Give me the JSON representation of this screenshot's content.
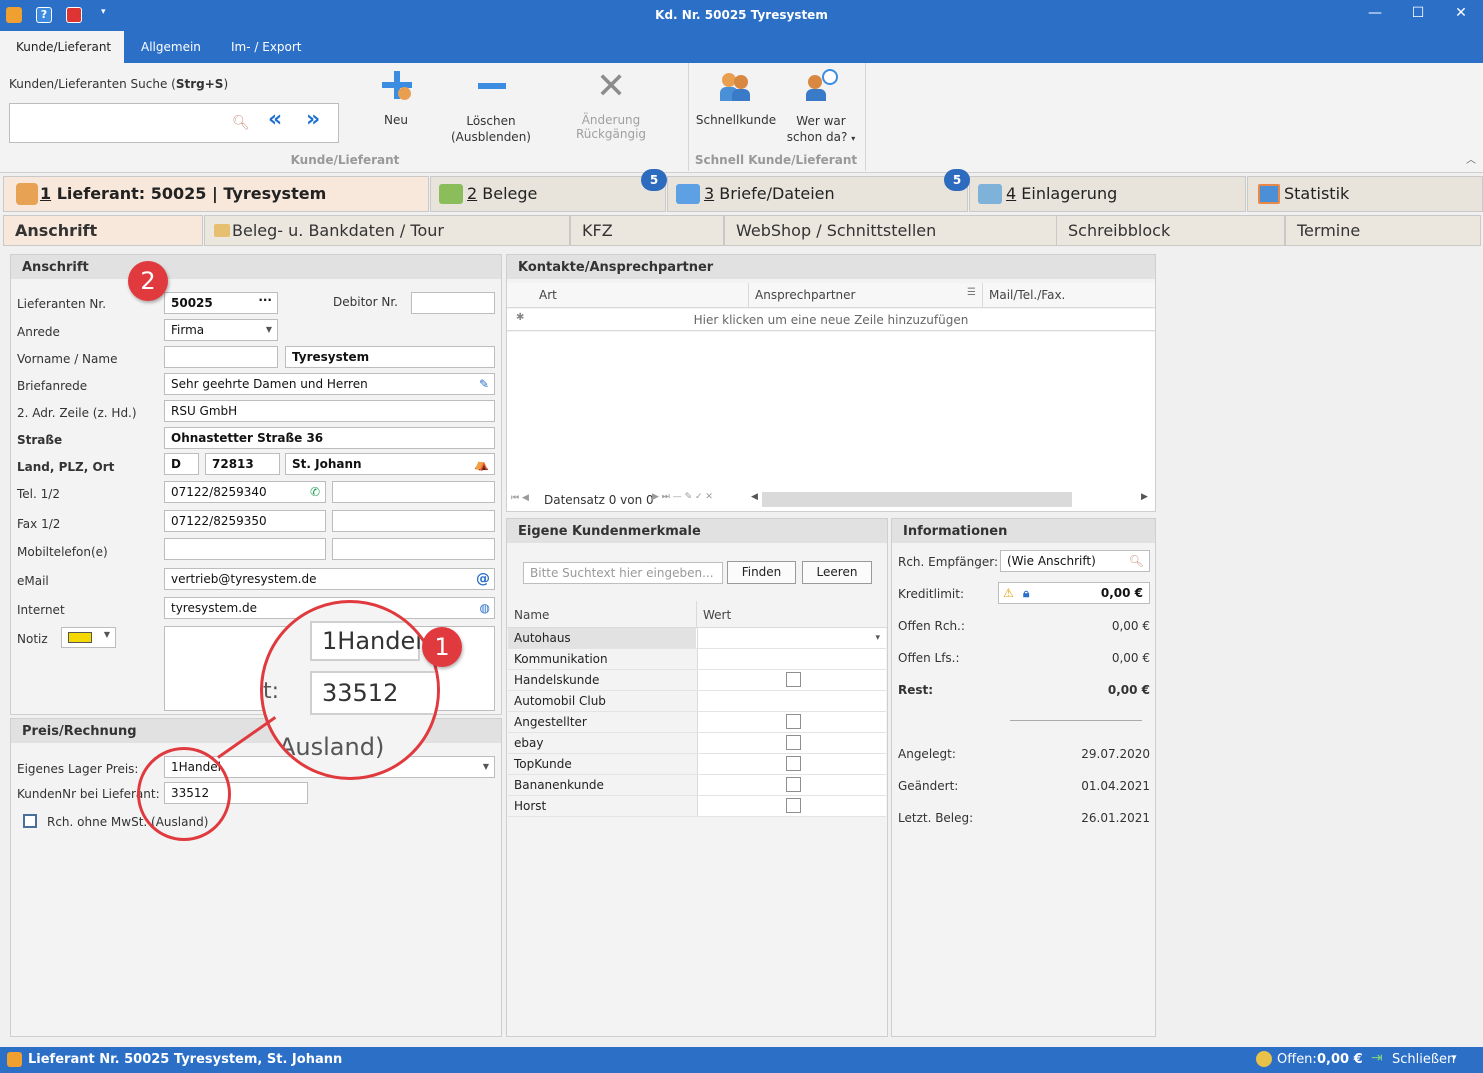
{
  "window": {
    "title": "Kd. Nr. 50025 Tyresystem"
  },
  "menu": {
    "items": [
      "Kunde/Lieferant",
      "Allgemein",
      "Im- / Export"
    ]
  },
  "ribbon": {
    "search_label": "Kunden/Lieferanten Suche (",
    "search_shortcut": "Strg+S",
    "search_close": ")",
    "search_value": "",
    "btn_new": "Neu",
    "btn_delete": "Löschen",
    "btn_delete_sub": "(Ausblenden)",
    "btn_undo": "Änderung Rückgängig",
    "group1": "Kunde/Lieferant",
    "btn_quick": "Schnellkunde",
    "btn_who": "Wer war",
    "btn_who_sub": "schon da?",
    "group2": "Schnell Kunde/Lieferant"
  },
  "tabs": {
    "main": [
      {
        "num": "1",
        "label": " Lieferant: 50025 | Tyresystem"
      },
      {
        "num": "2",
        "label": " Belege"
      },
      {
        "num": "3",
        "label": " Briefe/Dateien",
        "badge": "5"
      },
      {
        "num": "4",
        "label": " Einlagerung",
        "badge": "5"
      },
      {
        "num": "",
        "label": "Statistik"
      }
    ],
    "sub": [
      "Anschrift",
      "Beleg- u. Bankdaten / Tour",
      "KFZ",
      "WebShop / Schnittstellen",
      "Schreibblock",
      "Termine"
    ]
  },
  "anschrift": {
    "title": "Anschrift",
    "lieferanten_nr_label": "Lieferanten Nr.",
    "lieferanten_nr": "50025",
    "debitor_label": "Debitor Nr.",
    "debitor": "",
    "anrede_label": "Anrede",
    "anrede": "Firma",
    "vorname_label": "Vorname / Name",
    "vorname": "",
    "name": "Tyresystem",
    "briefanrede_label": "Briefanrede",
    "briefanrede": "Sehr geehrte Damen und Herren",
    "adr2_label": "2. Adr. Zeile (z. Hd.)",
    "adr2": "RSU GmbH",
    "strasse_label": "Straße",
    "strasse": "Ohnastetter Straße 36",
    "ort_label": "Land, PLZ, Ort",
    "land": "D",
    "plz": "72813",
    "ort": "St. Johann",
    "tel_label": "Tel. 1/2",
    "tel1": "07122/8259340",
    "tel2": "",
    "fax_label": "Fax 1/2",
    "fax1": "07122/8259350",
    "fax2": "",
    "mobil_label": "Mobiltelefon(e)",
    "mobil1": "",
    "mobil2": "",
    "email_label": "eMail",
    "email": "vertrieb@tyresystem.de",
    "internet_label": "Internet",
    "internet": "tyresystem.de",
    "notiz_label": "Notiz",
    "notiz": ""
  },
  "preis": {
    "title": "Preis/Rechnung",
    "lager_label": "Eigenes Lager Preis:",
    "lager": "1Handel",
    "kundennr_label": "KundenNr bei Lieferant:",
    "kundennr": "33512",
    "mwst_label": "Rch. ohne MwSt. (Ausland)"
  },
  "zoom": {
    "handel": "1Handel",
    "kdnr": "33512",
    "prefix": "t:",
    "ausland": "Ausland)"
  },
  "annotations": {
    "one": "1",
    "two": "2"
  },
  "kontakte": {
    "title": "Kontakte/Ansprechpartner",
    "columns": [
      "Art",
      "Ansprechpartner",
      "Mail/Tel./Fax."
    ],
    "new_row_hint": "Hier klicken um eine neue Zeile hinzuzufügen",
    "nav_text": "Datensatz 0 von 0"
  },
  "merkmale": {
    "title": "Eigene Kundenmerkmale",
    "search_placeholder": "Bitte Suchtext hier eingeben...",
    "btn_find": "Finden",
    "btn_clear": "Leeren",
    "col_name": "Name",
    "col_value": "Wert",
    "rows": [
      {
        "name": "Autohaus",
        "type": "dropdown"
      },
      {
        "name": "Kommunikation",
        "type": "text"
      },
      {
        "name": "Handelskunde",
        "type": "checkbox"
      },
      {
        "name": "Automobil Club",
        "type": "text"
      },
      {
        "name": "Angestellter",
        "type": "checkbox"
      },
      {
        "name": "ebay",
        "type": "checkbox"
      },
      {
        "name": "TopKunde",
        "type": "checkbox"
      },
      {
        "name": "Bananenkunde",
        "type": "checkbox"
      },
      {
        "name": "Horst",
        "type": "checkbox"
      }
    ]
  },
  "info": {
    "title": "Informationen",
    "empf_label": "Rch. Empfänger:",
    "empf": "(Wie Anschrift)",
    "kredit_label": "Kreditlimit:",
    "kredit": "0,00 €",
    "offen_rch_label": "Offen Rch.:",
    "offen_rch": "0,00 €",
    "offen_lfs_label": "Offen Lfs.:",
    "offen_lfs": "0,00 €",
    "rest_label": "Rest:",
    "rest": "0,00 €",
    "angelegt_label": "Angelegt:",
    "angelegt": "29.07.2020",
    "geaendert_label": "Geändert:",
    "geaendert": "01.04.2021",
    "letzt_label": "Letzt. Beleg:",
    "letzt": "26.01.2021"
  },
  "status": {
    "text": "Lieferant Nr. 50025 Tyresystem, St. Johann",
    "offen_label": "Offen:",
    "offen_value": "0,00 €",
    "close_label": "Schließen"
  },
  "colors": {
    "accent": "#2b6fc7",
    "annotation": "#e0393e",
    "active_tab": "#f8e8dc"
  }
}
